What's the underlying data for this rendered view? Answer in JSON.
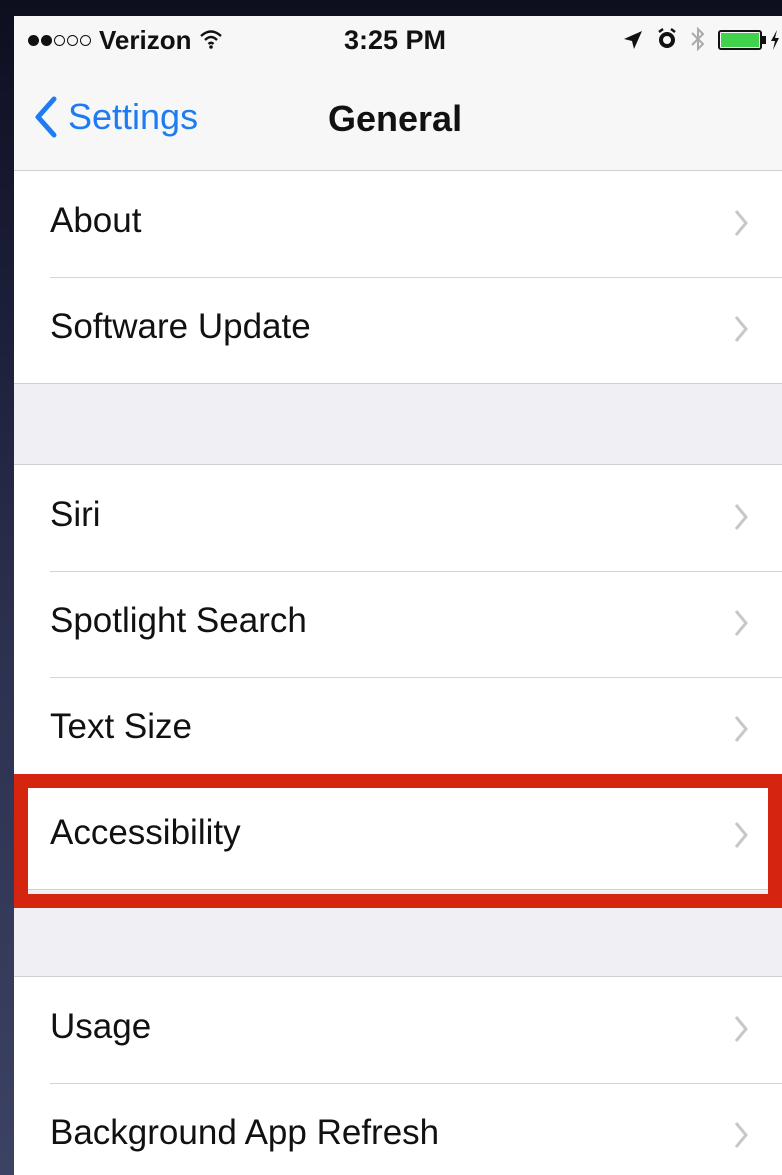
{
  "status_bar": {
    "carrier": "Verizon",
    "signal_bars_filled": 2,
    "signal_bars_total": 5,
    "time": "3:25 PM",
    "icons": [
      "wifi-icon",
      "location-arrow-icon",
      "alarm-icon",
      "bluetooth-icon",
      "battery-icon",
      "charging-icon"
    ]
  },
  "nav": {
    "back_label": "Settings",
    "title": "General"
  },
  "groups": [
    {
      "items": [
        {
          "label": "About"
        },
        {
          "label": "Software Update"
        }
      ]
    },
    {
      "items": [
        {
          "label": "Siri"
        },
        {
          "label": "Spotlight Search"
        },
        {
          "label": "Text Size"
        },
        {
          "label": "Accessibility"
        }
      ]
    },
    {
      "items": [
        {
          "label": "Usage"
        },
        {
          "label": "Background App Refresh"
        }
      ]
    }
  ],
  "highlighted_item": "Accessibility",
  "colors": {
    "accent": "#1e7cf2",
    "highlight_border": "#d6250f",
    "background": "#efeff4"
  }
}
